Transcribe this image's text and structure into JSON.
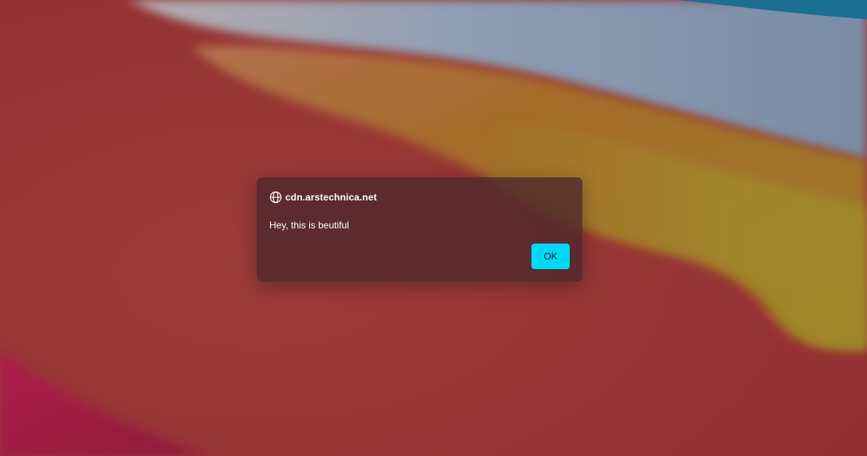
{
  "wallpaper": {
    "name": "abstract-gradient-wallpaper",
    "colors": {
      "red": "#9b3535",
      "orange": "#a2612c",
      "gold": "#a2882c",
      "slate_blue": "#8694ac",
      "teal": "#1a6f92",
      "magenta": "#a8164a"
    }
  },
  "dialog": {
    "icon": "globe-icon",
    "origin": "cdn.arstechnica.net",
    "message": "Hey, this is beutiful",
    "ok_label": "OK",
    "colors": {
      "background": "#5e2f31",
      "button": "#00d8f6",
      "button_text": "#1a1a1a",
      "text": "#ffffff"
    }
  }
}
